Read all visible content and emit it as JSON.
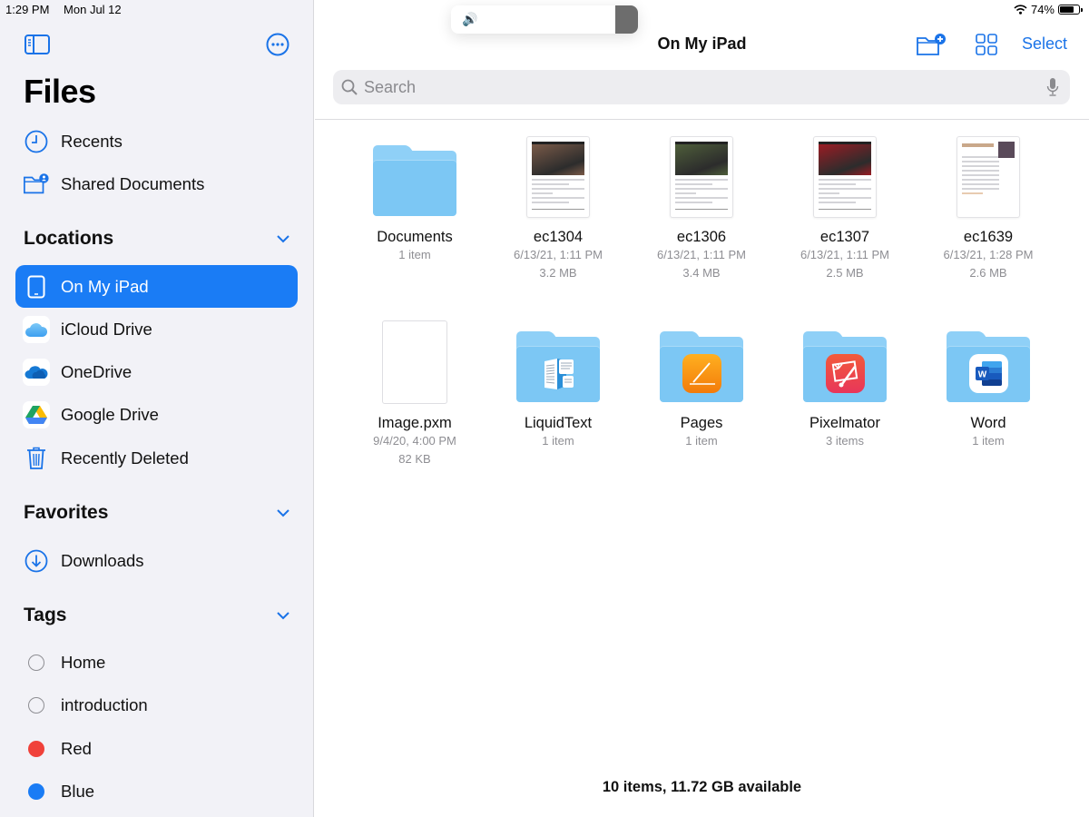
{
  "status_bar": {
    "time": "1:29 PM",
    "date": "Mon Jul 12",
    "battery_percent": "74%",
    "battery_level": 0.74
  },
  "volume_hud": {
    "icon": "speaker-icon",
    "level": 0.12
  },
  "sidebar": {
    "title": "Files",
    "toggle_icon": "sidebar-toggle-icon",
    "more_icon": "ellipsis-circle-icon",
    "top_items": [
      {
        "label": "Recents",
        "icon": "clock-icon"
      },
      {
        "label": "Shared Documents",
        "icon": "shared-folder-icon"
      }
    ],
    "sections": {
      "locations": {
        "title": "Locations",
        "items": [
          {
            "label": "On My iPad",
            "icon": "ipad-icon",
            "active": true
          },
          {
            "label": "iCloud Drive",
            "icon": "icloud-icon"
          },
          {
            "label": "OneDrive",
            "icon": "onedrive-icon"
          },
          {
            "label": "Google Drive",
            "icon": "google-drive-icon"
          },
          {
            "label": "Recently Deleted",
            "icon": "trash-icon"
          }
        ]
      },
      "favorites": {
        "title": "Favorites",
        "items": [
          {
            "label": "Downloads",
            "icon": "download-circle-icon"
          }
        ]
      },
      "tags": {
        "title": "Tags",
        "items": [
          {
            "label": "Home",
            "color": ""
          },
          {
            "label": "introduction",
            "color": ""
          },
          {
            "label": "Red",
            "color": "#f0413a"
          },
          {
            "label": "Blue",
            "color": "#1a7cf5"
          }
        ]
      }
    }
  },
  "header": {
    "title": "On My iPad",
    "new_folder_icon": "new-folder-icon",
    "view_icon": "grid-view-icon",
    "select_label": "Select"
  },
  "search": {
    "placeholder": "Search",
    "value": ""
  },
  "files": [
    {
      "name": "Documents",
      "type": "folder",
      "meta": [
        "1 item"
      ]
    },
    {
      "name": "ec1304",
      "type": "pdf",
      "meta": [
        "6/13/21, 1:11 PM",
        "3.2 MB"
      ],
      "hero_color": "#7a5a48",
      "hero_title": "GROWING BLUEBERRIES"
    },
    {
      "name": "ec1306",
      "type": "pdf",
      "meta": [
        "6/13/21, 1:11 PM",
        "3.4 MB"
      ],
      "hero_color": "#4e5e3a",
      "hero_title": "GROWING RASPBERRIES"
    },
    {
      "name": "ec1307",
      "type": "pdf",
      "meta": [
        "6/13/21, 1:11 PM",
        "2.5 MB"
      ],
      "hero_color": "#9b1c24",
      "hero_title": "GROWING STRAWBERRIES"
    },
    {
      "name": "ec1639",
      "type": "pdf-text",
      "meta": [
        "6/13/21, 1:28 PM",
        "2.6 MB"
      ],
      "hero_title": "Growing Table Grapes"
    },
    {
      "name": "Image.pxm",
      "type": "blank",
      "meta": [
        "9/4/20, 4:00 PM",
        "82 KB"
      ]
    },
    {
      "name": "LiquidText",
      "type": "app-folder",
      "app": "liquidtext",
      "meta": [
        "1 item"
      ]
    },
    {
      "name": "Pages",
      "type": "app-folder",
      "app": "pages",
      "meta": [
        "1 item"
      ]
    },
    {
      "name": "Pixelmator",
      "type": "app-folder",
      "app": "pixelmator",
      "meta": [
        "3 items"
      ]
    },
    {
      "name": "Word",
      "type": "app-folder",
      "app": "word",
      "meta": [
        "1 item"
      ]
    }
  ],
  "footer": {
    "summary": "10 items, 11.72 GB available"
  },
  "colors": {
    "accent": "#1a7cf5",
    "link": "#1a73e8",
    "sidebar_bg": "#f2f2f7",
    "folder_blue": "#7cc7f4"
  }
}
